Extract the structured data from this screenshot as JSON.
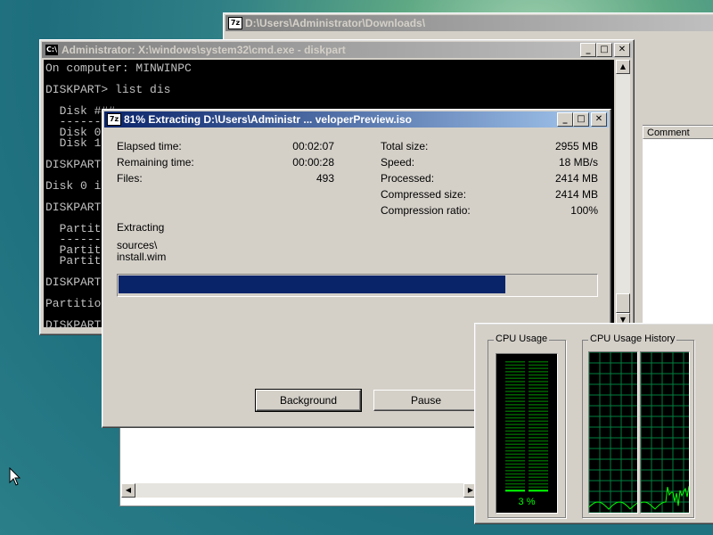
{
  "explorer": {
    "title": "D:\\Users\\Administrator\\Downloads\\",
    "icon": "7z-icon",
    "column_comment": "Comment"
  },
  "cmd": {
    "title": "Administrator: X:\\windows\\system32\\cmd.exe - diskpart",
    "lines": [
      "On computer: MINWINPC",
      "",
      "DISKPART> list dis",
      "",
      "  Disk ###",
      "  --------",
      "  Disk 0",
      "  Disk 1",
      "",
      "DISKPART",
      "",
      "Disk 0 i",
      "",
      "DISKPART",
      "",
      "  Partit",
      "  ------",
      "  Partit",
      "  Partit",
      "",
      "DISKPART",
      "",
      "Partitio",
      "",
      "DISKPART"
    ]
  },
  "zip": {
    "title": "81% Extracting D:\\Users\\Administr ... veloperPreview.iso",
    "progress_fraction": 0.81,
    "left_stats": [
      {
        "label": "Elapsed time:",
        "value": "00:02:07"
      },
      {
        "label": "Remaining time:",
        "value": "00:00:28"
      },
      {
        "label": "Files:",
        "value": "493"
      }
    ],
    "right_stats": [
      {
        "label": "Total size:",
        "value": "2955 MB"
      },
      {
        "label": "Speed:",
        "value": "18 MB/s"
      },
      {
        "label": "Processed:",
        "value": "2414 MB"
      },
      {
        "label": "Compressed size:",
        "value": "2414 MB"
      },
      {
        "label": "Compression ratio:",
        "value": "100%"
      }
    ],
    "status": "Extracting",
    "path_line1": "sources\\",
    "path_line2": "install.wim",
    "buttons": {
      "background": "Background",
      "pause": "Pause"
    }
  },
  "taskmgr": {
    "cpu_usage_title": "CPU Usage",
    "cpu_usage_value": "3 %",
    "cpu_usage_fraction": 0.03,
    "history_title": "CPU Usage History"
  },
  "colors": {
    "progress": "#0a246a",
    "graph": "#00ff00",
    "grid": "#008040"
  }
}
